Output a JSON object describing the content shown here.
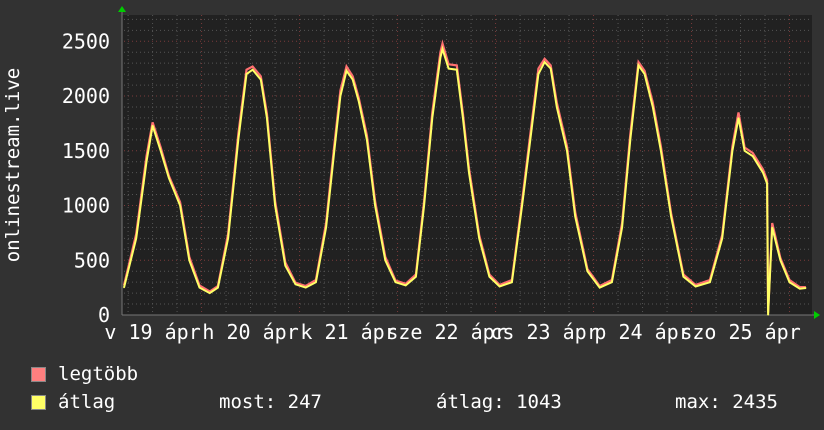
{
  "chart_data": {
    "type": "line",
    "ylabel": "onlinestream.live",
    "ylim": [
      0,
      2740
    ],
    "xlim": [
      "2020-04-19 05:00",
      "2020-04-26 05:30"
    ],
    "yticks": [
      0,
      500,
      1000,
      1500,
      2000,
      2500
    ],
    "xtick_labels": [
      "v 19 ápr",
      "h 20 ápr",
      "k 21 ápr",
      "sze 22 ápr",
      "cs 23 ápr",
      "p 24 ápr",
      "szo 25 ápr"
    ],
    "grid": true,
    "colors": {
      "max": "#ff7070",
      "avg": "#ffff66",
      "major_grid": "#7a3a3a",
      "minor_grid": "#555555",
      "arrow": "#00cc00"
    },
    "series_names": [
      "legtöbb",
      "átlag"
    ],
    "points": [
      [
        "2020-04-19 05:00",
        270,
        250
      ],
      [
        "2020-04-19 08:00",
        740,
        700
      ],
      [
        "2020-04-19 10:30",
        1450,
        1400
      ],
      [
        "2020-04-19 12:00",
        1760,
        1730
      ],
      [
        "2020-04-19 14:00",
        1530,
        1500
      ],
      [
        "2020-04-19 16:00",
        1270,
        1250
      ],
      [
        "2020-04-19 18:45",
        1030,
        1000
      ],
      [
        "2020-04-19 21:00",
        530,
        500
      ],
      [
        "2020-04-19 23:30",
        270,
        250
      ],
      [
        "2020-04-20 02:00",
        215,
        200
      ],
      [
        "2020-04-20 04:00",
        265,
        250
      ],
      [
        "2020-04-20 06:30",
        740,
        700
      ],
      [
        "2020-04-20 09:00",
        1650,
        1600
      ],
      [
        "2020-04-20 11:00",
        2240,
        2200
      ],
      [
        "2020-04-20 12:30",
        2270,
        2240
      ],
      [
        "2020-04-20 14:30",
        2180,
        2150
      ],
      [
        "2020-04-20 16:00",
        1840,
        1800
      ],
      [
        "2020-04-20 18:00",
        1040,
        1000
      ],
      [
        "2020-04-20 20:30",
        480,
        450
      ],
      [
        "2020-04-20 23:00",
        295,
        280
      ],
      [
        "2020-04-21 01:30",
        265,
        250
      ],
      [
        "2020-04-21 04:00",
        320,
        300
      ],
      [
        "2020-04-21 06:30",
        840,
        800
      ],
      [
        "2020-04-21 08:30",
        1550,
        1500
      ],
      [
        "2020-04-21 10:00",
        2050,
        2000
      ],
      [
        "2020-04-21 11:30",
        2270,
        2230
      ],
      [
        "2020-04-21 13:00",
        2180,
        2150
      ],
      [
        "2020-04-21 14:30",
        1980,
        1950
      ],
      [
        "2020-04-21 16:30",
        1640,
        1600
      ],
      [
        "2020-04-21 18:30",
        1040,
        1000
      ],
      [
        "2020-04-21 21:00",
        530,
        500
      ],
      [
        "2020-04-21 23:30",
        315,
        300
      ],
      [
        "2020-04-22 02:00",
        285,
        270
      ],
      [
        "2020-04-22 04:30",
        370,
        350
      ],
      [
        "2020-04-22 06:30",
        1040,
        1000
      ],
      [
        "2020-04-22 08:30",
        1850,
        1800
      ],
      [
        "2020-04-22 10:30",
        2400,
        2350
      ],
      [
        "2020-04-22 11:00",
        2480,
        2430
      ],
      [
        "2020-04-22 12:30",
        2290,
        2250
      ],
      [
        "2020-04-22 14:30",
        2280,
        2240
      ],
      [
        "2020-04-22 16:00",
        1840,
        1800
      ],
      [
        "2020-04-22 17:30",
        1340,
        1300
      ],
      [
        "2020-04-22 20:00",
        730,
        700
      ],
      [
        "2020-04-22 22:30",
        370,
        350
      ],
      [
        "2020-04-23 01:00",
        275,
        260
      ],
      [
        "2020-04-23 04:00",
        320,
        300
      ],
      [
        "2020-04-23 06:30",
        1040,
        1000
      ],
      [
        "2020-04-23 08:30",
        1650,
        1600
      ],
      [
        "2020-04-23 10:30",
        2250,
        2200
      ],
      [
        "2020-04-23 12:00",
        2340,
        2310
      ],
      [
        "2020-04-23 13:30",
        2280,
        2250
      ],
      [
        "2020-04-23 15:00",
        1940,
        1900
      ],
      [
        "2020-04-23 17:30",
        1540,
        1500
      ],
      [
        "2020-04-23 19:30",
        940,
        900
      ],
      [
        "2020-04-23 22:30",
        420,
        400
      ],
      [
        "2020-04-24 01:30",
        265,
        250
      ],
      [
        "2020-04-24 04:30",
        320,
        300
      ],
      [
        "2020-04-24 07:00",
        840,
        800
      ],
      [
        "2020-04-24 09:00",
        1650,
        1600
      ],
      [
        "2020-04-24 11:00",
        2310,
        2280
      ],
      [
        "2020-04-24 12:30",
        2230,
        2200
      ],
      [
        "2020-04-24 14:30",
        1940,
        1900
      ],
      [
        "2020-04-24 16:30",
        1540,
        1500
      ],
      [
        "2020-04-24 19:00",
        930,
        900
      ],
      [
        "2020-04-24 22:00",
        370,
        350
      ],
      [
        "2020-04-25 01:00",
        275,
        260
      ],
      [
        "2020-04-25 04:30",
        320,
        300
      ],
      [
        "2020-04-25 07:30",
        730,
        700
      ],
      [
        "2020-04-25 10:00",
        1540,
        1500
      ],
      [
        "2020-04-25 11:30",
        1850,
        1800
      ],
      [
        "2020-04-25 13:00",
        1530,
        1500
      ],
      [
        "2020-04-25 15:00",
        1480,
        1450
      ],
      [
        "2020-04-25 17:30",
        1330,
        1300
      ],
      [
        "2020-04-25 18:30",
        1230,
        1200
      ],
      [
        "2020-04-25 18:45",
        20,
        0
      ],
      [
        "2020-04-25 19:45",
        840,
        800
      ],
      [
        "2020-04-25 21:45",
        520,
        500
      ],
      [
        "2020-04-26 00:00",
        320,
        300
      ],
      [
        "2020-04-26 02:30",
        255,
        240
      ],
      [
        "2020-04-26 04:00",
        255,
        247
      ]
    ]
  },
  "legend": {
    "items": [
      {
        "label": "legtöbb",
        "color": "#ff7f7f"
      },
      {
        "label": "átlag",
        "color": "#ffff66"
      }
    ],
    "stats": {
      "now": "most: 247",
      "avg": "átlag: 1043",
      "max": "max: 2435"
    }
  }
}
